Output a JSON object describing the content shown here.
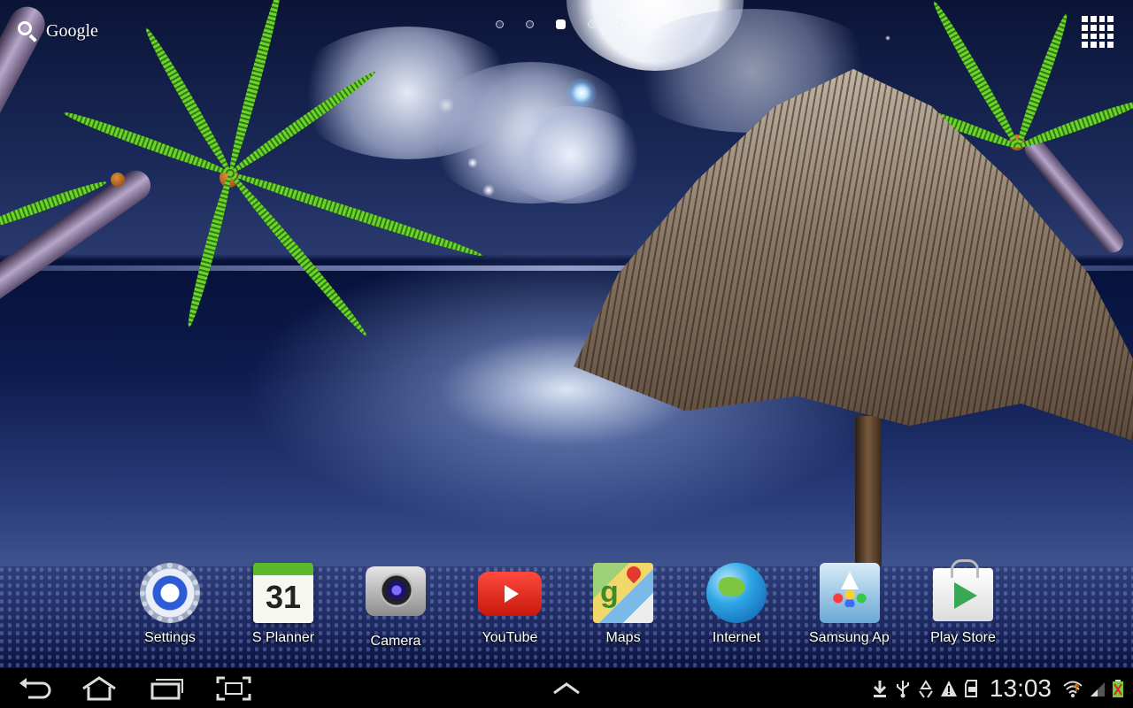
{
  "search": {
    "label": "Google"
  },
  "page_indicator": {
    "pages": 5,
    "active_index": 2
  },
  "apps_button": {
    "icon": "apps-grid-icon"
  },
  "dock": {
    "items": [
      {
        "label": "Settings",
        "icon": "settings-icon"
      },
      {
        "label": "S Planner",
        "icon": "calendar-icon",
        "icon_text": "31"
      },
      {
        "label": "Camera",
        "icon": "camera-icon"
      },
      {
        "label": "YouTube",
        "icon": "youtube-icon"
      },
      {
        "label": "Maps",
        "icon": "maps-icon"
      },
      {
        "label": "Internet",
        "icon": "globe-icon"
      },
      {
        "label": "Samsung Apps",
        "icon": "samsung-apps-icon"
      },
      {
        "label": "Play Store",
        "icon": "play-store-icon"
      }
    ]
  },
  "nav_bar": {
    "buttons": [
      "back-icon",
      "home-icon",
      "recent-apps-icon",
      "screenshot-icon"
    ],
    "center": "chevron-up-icon"
  },
  "status_bar": {
    "time": "13:03",
    "icons": [
      "download-icon",
      "usb-icon",
      "recycle-icon",
      "warning-icon",
      "sd-card-icon",
      "wifi-icon",
      "signal-icon",
      "battery-charging-icon"
    ]
  },
  "colors": {
    "wallpaper_sky": "#0a1436",
    "sea": "#0c1a4d",
    "nav_bar": "#000000"
  }
}
